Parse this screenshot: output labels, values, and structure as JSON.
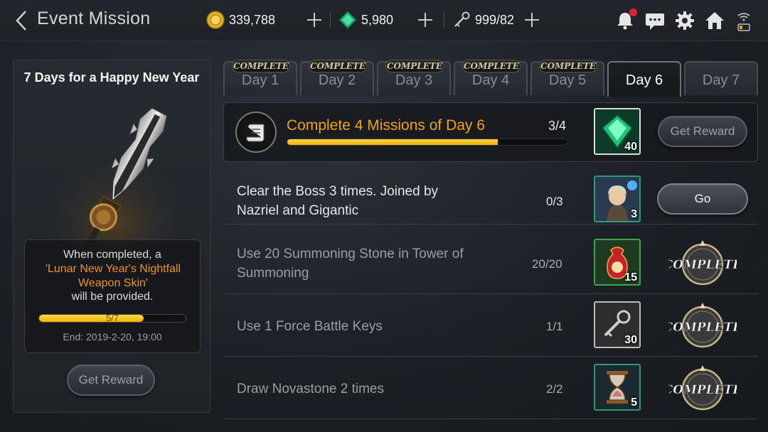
{
  "header": {
    "title": "Event Mission",
    "gold": "339,788",
    "gems": "5,980",
    "keys": "999/82"
  },
  "left_panel": {
    "title": "7 Days for a Happy New Year",
    "completed_text": "When completed, a",
    "reward_name": "'Lunar New Year's Nightfall Weapon Skin'",
    "provided_text": "will be provided.",
    "progress_text": "5/7",
    "progress_fraction": 0.714,
    "end_text": "End: 2019-2-20, 19:00",
    "button_label": "Get Reward"
  },
  "tabs": [
    {
      "label": "Day 1",
      "badge": "COMPLETE"
    },
    {
      "label": "Day 2",
      "badge": "COMPLETE"
    },
    {
      "label": "Day 3",
      "badge": "COMPLETE"
    },
    {
      "label": "Day 4",
      "badge": "COMPLETE"
    },
    {
      "label": "Day 5",
      "badge": "COMPLETE"
    },
    {
      "label": "Day 6",
      "badge": ""
    },
    {
      "label": "Day 7",
      "badge": ""
    }
  ],
  "mission_header": {
    "title": "Complete 4 Missions of Day 6",
    "count": "3/4",
    "progress_fraction": 0.75,
    "reward_qty": "40",
    "button_label": "Get Reward"
  },
  "missions": [
    {
      "title": "Clear the Boss 3 times. Joined by Nazriel and Gigantic",
      "count": "0/3",
      "reward_qty": "3",
      "action": "Go"
    },
    {
      "title": "Use 20 Summoning Stone in Tower of Summoning",
      "count": "20/20",
      "reward_qty": "15",
      "action": "COMPLETE"
    },
    {
      "title": "Use 1 Force Battle Keys",
      "count": "1/1",
      "reward_qty": "30",
      "action": "COMPLETE"
    },
    {
      "title": "Draw Novastone 2 times",
      "count": "2/2",
      "reward_qty": "5",
      "action": "COMPLETE"
    }
  ],
  "icons": {
    "back": "chevron-left-icon",
    "gold": "gold-coin-icon",
    "gem": "green-gem-icon",
    "key": "key-icon",
    "bell": "bell-icon",
    "chat": "chat-icon",
    "gear": "gear-icon",
    "home": "home-icon",
    "signal": "signal-battery-icon"
  },
  "colors": {
    "accent_orange": "#f3a11f",
    "progress_yellow": "#f1b400",
    "reward_border": "#2a9a7e"
  }
}
